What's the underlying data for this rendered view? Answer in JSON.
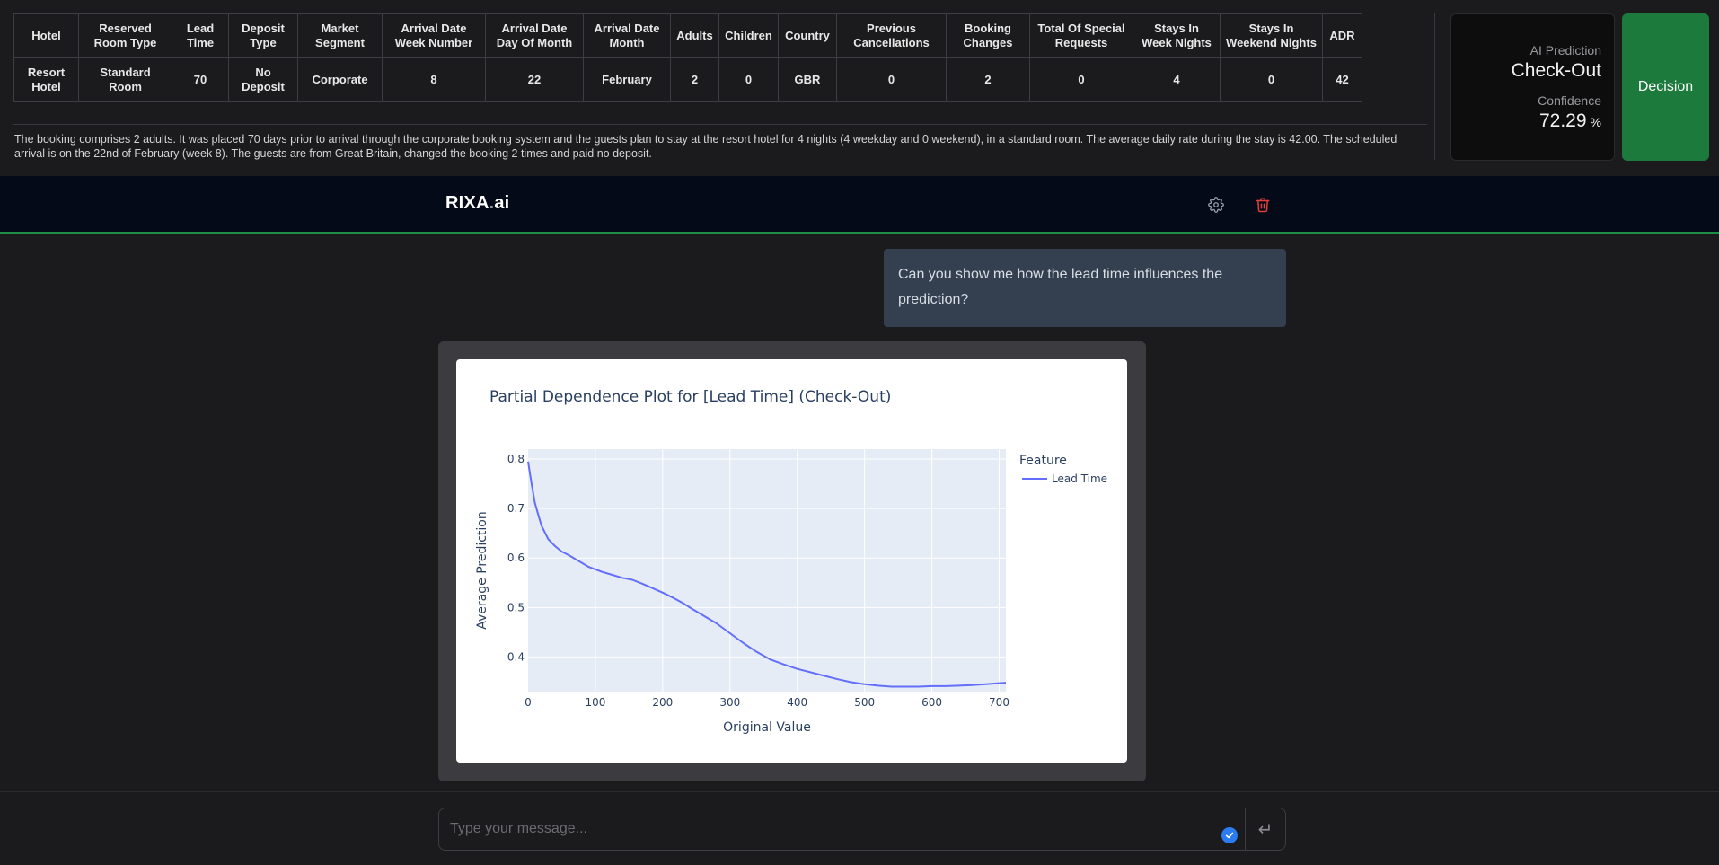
{
  "booking_table": {
    "headers": [
      "Hotel",
      "Reserved Room Type",
      "Lead Time",
      "Deposit Type",
      "Market Segment",
      "Arrival Date Week Number",
      "Arrival Date Day Of Month",
      "Arrival Date Month",
      "Adults",
      "Children",
      "Country",
      "Previous Cancellations",
      "Booking Changes",
      "Total Of Special Requests",
      "Stays In Week Nights",
      "Stays In Weekend Nights",
      "ADR"
    ],
    "row": [
      "Resort Hotel",
      "Standard Room",
      "70",
      "No Deposit",
      "Corporate",
      "8",
      "22",
      "February",
      "2",
      "0",
      "GBR",
      "0",
      "2",
      "0",
      "4",
      "0",
      "42"
    ]
  },
  "summary_text": "The booking comprises 2 adults. It was placed 70 days prior to arrival through the corporate booking system and the guests plan to stay at the resort hotel for 4 nights (4 weekday and 0 weekend), in a standard room. The average daily rate during the stay is 42.00. The scheduled arrival is on the 22nd of February (week 8). The guests are from Great Britain, changed the booking 2 times and paid no deposit.",
  "prediction": {
    "label": "AI Prediction",
    "value": "Check-Out",
    "confidence_label": "Confidence",
    "confidence_value": "72.29",
    "confidence_unit": "%"
  },
  "decision_button": "Decision",
  "header": {
    "logo_main": "RIXA",
    "logo_dot": ".",
    "logo_suffix": "ai",
    "icons": [
      "gear-icon",
      "trash-icon"
    ]
  },
  "chat": {
    "user_message": "Can you show me how the lead time influences the prediction?"
  },
  "chart_data": {
    "type": "line",
    "title": "Partial Dependence Plot for [Lead Time] (Check-Out)",
    "xlabel": "Original Value",
    "ylabel": "Average Prediction",
    "xlim": [
      0,
      710
    ],
    "ylim": [
      0.33,
      0.82
    ],
    "x_ticks": [
      0,
      100,
      200,
      300,
      400,
      500,
      600,
      700
    ],
    "y_ticks": [
      0.4,
      0.5,
      0.6,
      0.7,
      0.8
    ],
    "legend_title": "Feature",
    "legend_position": "top-right",
    "grid": true,
    "colors": {
      "line": "#636efa",
      "plot_bg": "#e5ecf6",
      "text": "#2a3f5f"
    },
    "series": [
      {
        "name": "Lead Time",
        "x": [
          0,
          5,
          10,
          15,
          20,
          30,
          40,
          50,
          60,
          75,
          90,
          110,
          125,
          140,
          155,
          170,
          185,
          200,
          215,
          230,
          245,
          260,
          280,
          300,
          320,
          340,
          360,
          380,
          400,
          420,
          440,
          460,
          480,
          500,
          520,
          540,
          560,
          580,
          600,
          620,
          640,
          660,
          680,
          700,
          710
        ],
        "y": [
          0.795,
          0.752,
          0.712,
          0.688,
          0.665,
          0.638,
          0.624,
          0.613,
          0.606,
          0.594,
          0.582,
          0.572,
          0.566,
          0.56,
          0.556,
          0.548,
          0.539,
          0.53,
          0.52,
          0.509,
          0.496,
          0.484,
          0.468,
          0.448,
          0.428,
          0.41,
          0.395,
          0.385,
          0.376,
          0.369,
          0.362,
          0.355,
          0.349,
          0.345,
          0.342,
          0.34,
          0.34,
          0.34,
          0.341,
          0.341,
          0.342,
          0.343,
          0.345,
          0.347,
          0.348
        ]
      }
    ]
  },
  "input": {
    "placeholder": "Type your message...",
    "send_symbol": "↵"
  }
}
